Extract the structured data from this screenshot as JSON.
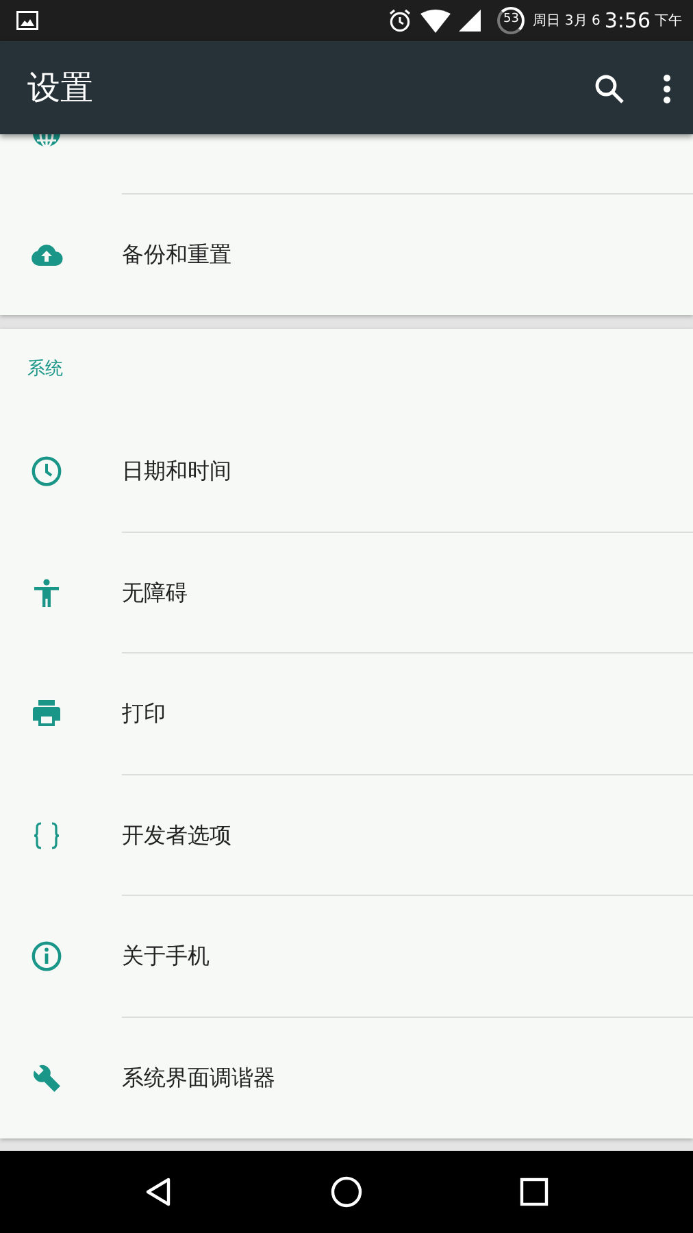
{
  "status_bar": {
    "battery": "53",
    "date": "周日 3月 6",
    "time": "3:56",
    "period": "下午"
  },
  "app_bar": {
    "title": "设置"
  },
  "sections": [
    {
      "scrolled_under_bar": true,
      "items": [
        {
          "label": "备份和重置"
        }
      ]
    },
    {
      "header": "系统",
      "items": [
        {
          "label": "日期和时间"
        },
        {
          "label": "无障碍"
        },
        {
          "label": "打印"
        },
        {
          "label": "开发者选项"
        },
        {
          "label": "关于手机"
        },
        {
          "label": "系统界面调谐器"
        }
      ]
    }
  ]
}
